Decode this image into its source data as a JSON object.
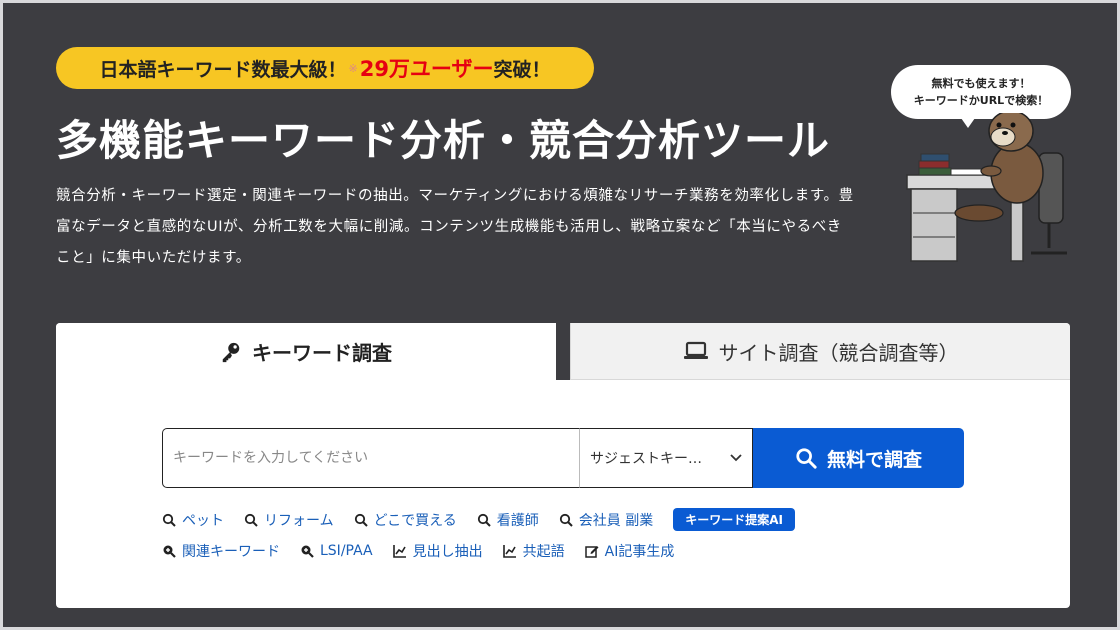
{
  "hero": {
    "badge_prefix": "日本語キーワード数最大級！",
    "badge_mark": "※",
    "badge_highlight": "29万ユーザー",
    "badge_suffix": "突破！",
    "title": "多機能キーワード分析・競合分析ツール",
    "description": "競合分析・キーワード選定・関連キーワードの抽出。マーケティングにおける煩雑なリサーチ業務を効率化します。豊富なデータと直感的なUIが、分析工数を大幅に削減。コンテンツ生成機能も活用し、戦略立案など「本当にやるべきこと」に集中いただけます。"
  },
  "mascot": {
    "bubble_line1": "無料でも使えます！",
    "bubble_line2": "キーワードかURLで検索！"
  },
  "tabs": {
    "keyword_label": "キーワード調査",
    "site_label": "サイト調査（競合調査等）"
  },
  "search": {
    "placeholder": "キーワードを入力してください",
    "select_value": "サジェストキー…",
    "button_label": "無料で調査"
  },
  "quick_links": {
    "row1": [
      "ペット",
      "リフォーム",
      "どこで買える",
      "看護師",
      "会社員 副業"
    ],
    "ai_button": "キーワード提案AI",
    "row2": [
      "関連キーワード",
      "LSI/PAA",
      "見出し抽出",
      "共起語",
      "AI記事生成"
    ]
  },
  "colors": {
    "background": "#3d3d41",
    "badge": "#f7c623",
    "highlight": "#e60012",
    "accent": "#0a5bd3",
    "link": "#1a5fb8"
  },
  "icons": {
    "keyword_tab": "key-icon",
    "site_tab": "laptop-icon",
    "search_button": "search-icon",
    "select": "chevron-down-icon",
    "row1_links": "search-icon",
    "row2_links": [
      "zoom-plus-icon",
      "zoom-plus-icon",
      "line-chart-icon",
      "line-chart-icon",
      "edit-icon"
    ]
  }
}
